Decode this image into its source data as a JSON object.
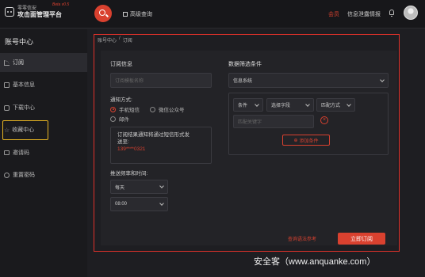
{
  "header": {
    "logo_line1": "零零信安",
    "logo_line2": "攻击面管理平台",
    "logo_badge": "Beta v0.5",
    "advanced_search": "高级查询",
    "nav_member": "会员",
    "nav_intel": "信息泄露情报"
  },
  "sidebar": {
    "title": "账号中心",
    "items": [
      {
        "label": "订阅",
        "icon": "rss-icon"
      },
      {
        "label": "基本信息",
        "icon": "document-icon"
      },
      {
        "label": "下载中心",
        "icon": "download-icon"
      },
      {
        "label": "收藏中心",
        "icon": "star-icon"
      },
      {
        "label": "邀请码",
        "icon": "mail-icon"
      },
      {
        "label": "重置密码",
        "icon": "reset-icon"
      }
    ]
  },
  "breadcrumb": [
    "账号中心",
    "/",
    "订阅"
  ],
  "subscription": {
    "section_title": "订阅信息",
    "name_placeholder": "订阅模板名称",
    "notify_label": "通知方式:",
    "options": {
      "sms": "手机短信",
      "wechat": "微信公众号",
      "email": "邮件"
    },
    "notice_line1": "订阅结果通知将通过短信形式发",
    "notice_line2": "送至:",
    "notice_phone": "139****0321",
    "freq_label": "推送频率和时间:",
    "freq_value": "每天",
    "time_value": "08:00"
  },
  "filter": {
    "section_title": "数据筛选条件",
    "source_value": "信息系统",
    "cond_field": "条件",
    "cond_field2": "选择字段",
    "cond_match": "匹配方式",
    "keyword_placeholder": "匹配关键字",
    "add_condition": "添加条件"
  },
  "footer": {
    "reference_link": "查询语法参考",
    "subscribe_button": "立即订阅"
  },
  "watermark": "安全客（www.anquanke.com）",
  "colors": {
    "accent": "#d9412f",
    "highlight": "#e6b422",
    "frame": "#e0312a"
  }
}
